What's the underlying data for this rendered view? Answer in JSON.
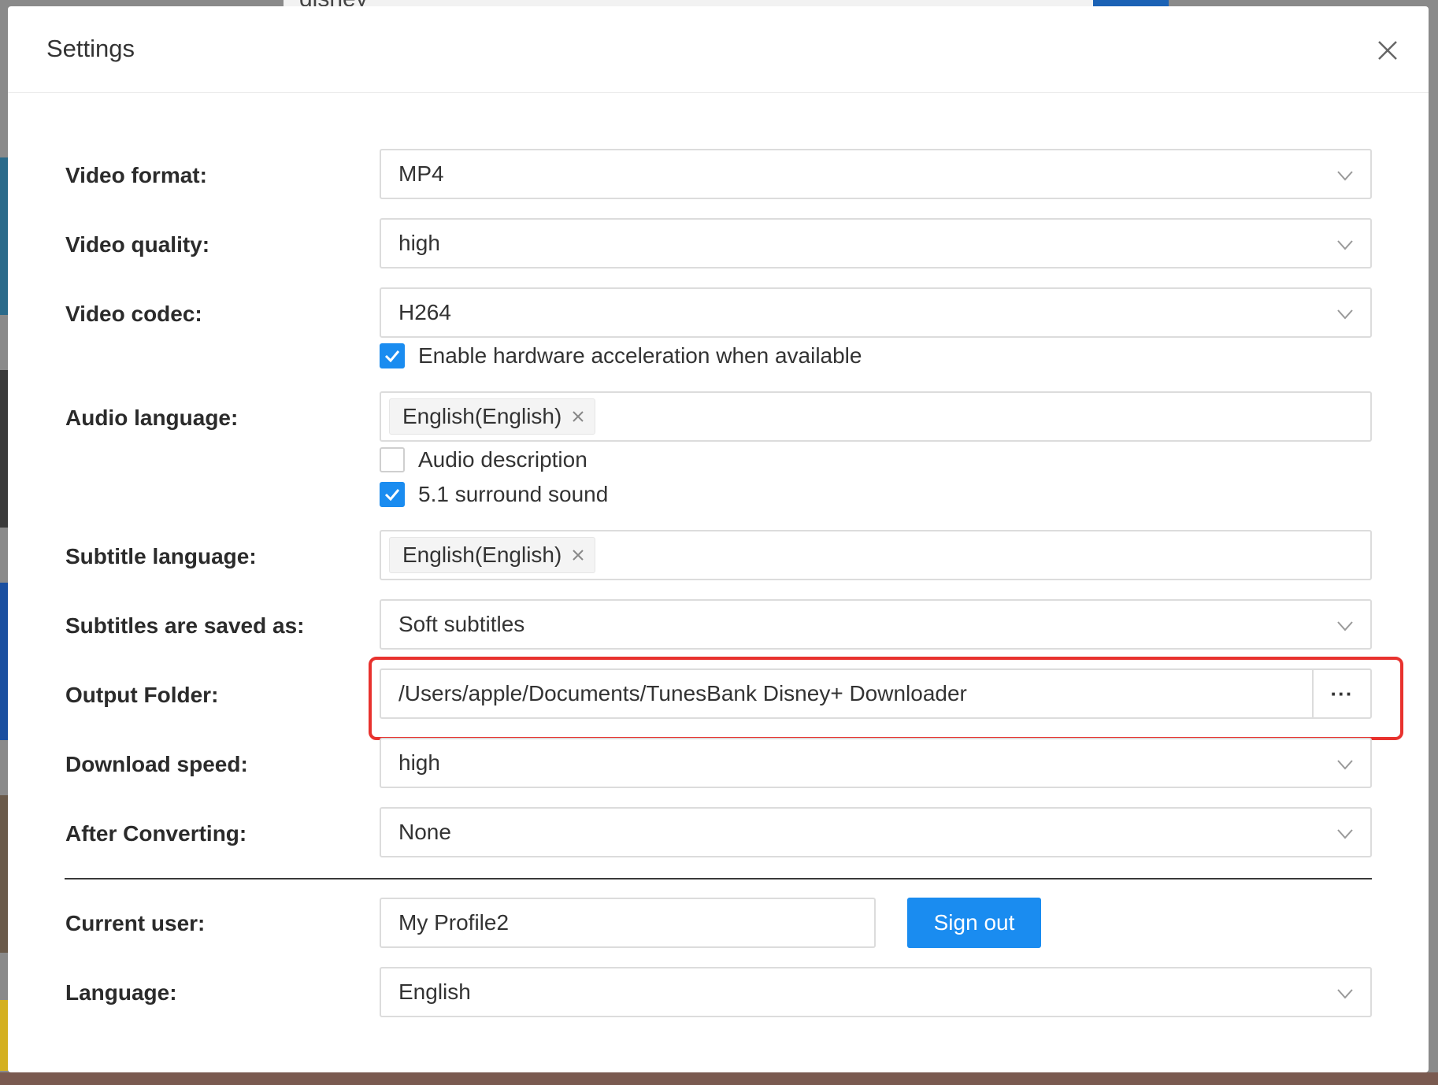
{
  "background": {
    "search_text": "disney"
  },
  "dialog": {
    "title": "Settings"
  },
  "video_format": {
    "label": "Video format:",
    "value": "MP4"
  },
  "video_quality": {
    "label": "Video quality:",
    "value": "high"
  },
  "video_codec": {
    "label": "Video codec:",
    "value": "H264",
    "hw_accel_label": "Enable hardware acceleration when available",
    "hw_accel_checked": true
  },
  "audio_language": {
    "label": "Audio language:",
    "tag": "English(English)",
    "audio_description_label": "Audio description",
    "audio_description_checked": false,
    "surround_label": "5.1 surround sound",
    "surround_checked": true
  },
  "subtitle_language": {
    "label": "Subtitle language:",
    "tag": "English(English)"
  },
  "subtitles_saved_as": {
    "label": "Subtitles are saved as:",
    "value": "Soft subtitles"
  },
  "output_folder": {
    "label": "Output Folder:",
    "value": "/Users/apple/Documents/TunesBank Disney+ Downloader",
    "browse_label": "···"
  },
  "download_speed": {
    "label": "Download speed:",
    "value": "high"
  },
  "after_converting": {
    "label": "After Converting:",
    "value": "None"
  },
  "current_user": {
    "label": "Current user:",
    "value": "My Profile2",
    "sign_out_label": "Sign out"
  },
  "language": {
    "label": "Language:",
    "value": "English"
  },
  "colors": {
    "accent": "#1a8cf0",
    "highlight": "#e8322e"
  }
}
